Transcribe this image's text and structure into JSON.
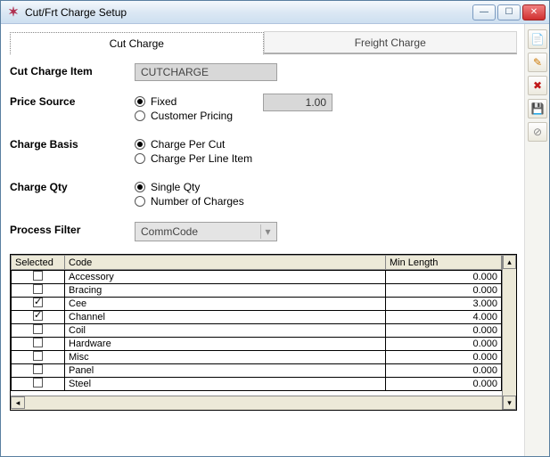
{
  "window": {
    "title": "Cut/Frt Charge Setup"
  },
  "tabs": {
    "cut": "Cut Charge",
    "freight": "Freight Charge"
  },
  "form": {
    "cut_charge_item_label": "Cut Charge Item",
    "cut_charge_item_value": "CUTCHARGE",
    "price_source_label": "Price Source",
    "price_source_options": {
      "fixed": "Fixed",
      "customer": "Customer Pricing"
    },
    "price_value": "1.00",
    "charge_basis_label": "Charge Basis",
    "charge_basis_options": {
      "per_cut": "Charge Per Cut",
      "per_line": "Charge Per Line Item"
    },
    "charge_qty_label": "Charge Qty",
    "charge_qty_options": {
      "single": "Single Qty",
      "num": "Number of Charges"
    },
    "process_filter_label": "Process Filter",
    "process_filter_value": "CommCode"
  },
  "table": {
    "headers": {
      "selected": "Selected",
      "code": "Code",
      "min_length": "Min Length"
    },
    "rows": [
      {
        "selected": false,
        "code": "Accessory",
        "min_length": "0.000"
      },
      {
        "selected": false,
        "code": "Bracing",
        "min_length": "0.000"
      },
      {
        "selected": true,
        "code": "Cee",
        "min_length": "3.000"
      },
      {
        "selected": true,
        "code": "Channel",
        "min_length": "4.000"
      },
      {
        "selected": false,
        "code": "Coil",
        "min_length": "0.000"
      },
      {
        "selected": false,
        "code": "Hardware",
        "min_length": "0.000"
      },
      {
        "selected": false,
        "code": "Misc",
        "min_length": "0.000"
      },
      {
        "selected": false,
        "code": "Panel",
        "min_length": "0.000"
      },
      {
        "selected": false,
        "code": "Steel",
        "min_length": "0.000"
      }
    ]
  },
  "toolbar_icons": {
    "new": "new-icon",
    "edit": "edit-icon",
    "delete": "delete-icon",
    "save": "save-icon",
    "cancel": "cancel-icon"
  }
}
